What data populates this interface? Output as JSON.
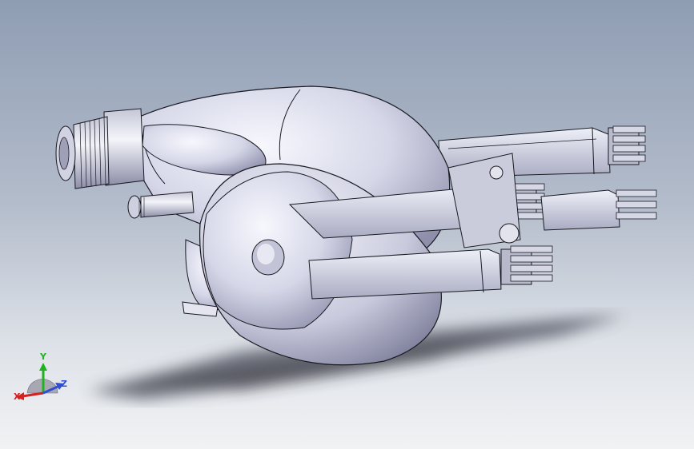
{
  "viewport": {
    "background_top": "#8f9db3",
    "background_bottom": "#f1f2f4",
    "model_color": "#d9dbeb"
  },
  "triad": {
    "x_label": "X",
    "y_label": "Y",
    "z_label": "Z",
    "x_color": "#d61f1f",
    "y_color": "#21b21f",
    "z_color": "#2f4fd0"
  }
}
